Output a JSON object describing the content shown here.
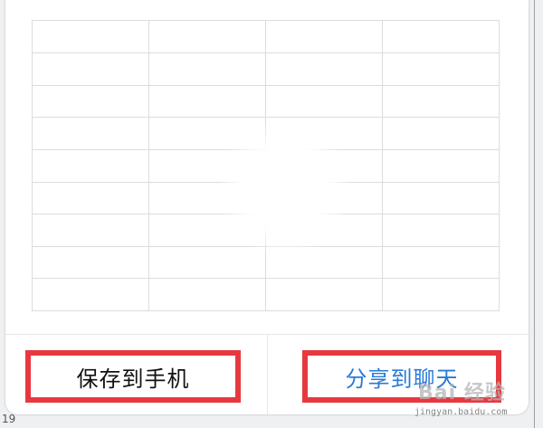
{
  "dialog": {
    "save_button_label": "保存到手机",
    "share_button_label": "分享到聊天"
  },
  "background": {
    "row_number": "19"
  },
  "watermark": {
    "main": "Bai 经验",
    "sub": "jingyan.baidu.com"
  },
  "colors": {
    "highlight_border": "#e8383f",
    "share_text": "#2a7ad6",
    "save_text": "#111111"
  }
}
